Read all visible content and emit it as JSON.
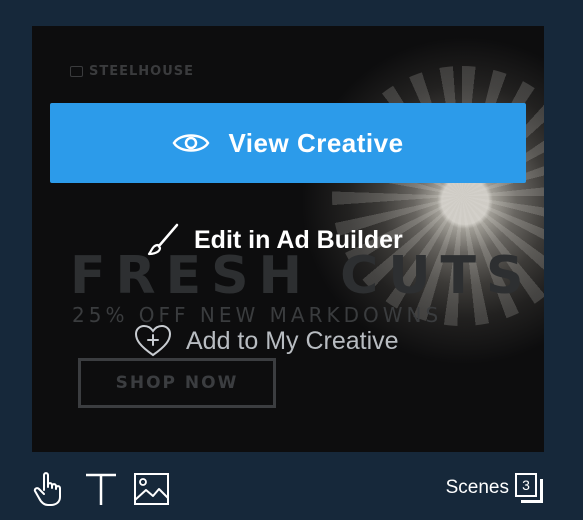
{
  "ad": {
    "brand": "STEELHOUSE",
    "headline": "FRESH CUTS",
    "subline": "25% OFF NEW MARKDOWNS",
    "cta": "SHOP NOW"
  },
  "actions": {
    "view": "View Creative",
    "edit": "Edit in Ad Builder",
    "add": "Add to My Creative"
  },
  "toolbar": {
    "scenes_label": "Scenes",
    "scenes_count": "3",
    "icons": [
      "hand-pointer-icon",
      "text-tool-icon",
      "image-tool-icon"
    ]
  },
  "colors": {
    "background": "#16283a",
    "primary": "#2c9bea",
    "card": "#0d0d0e"
  }
}
